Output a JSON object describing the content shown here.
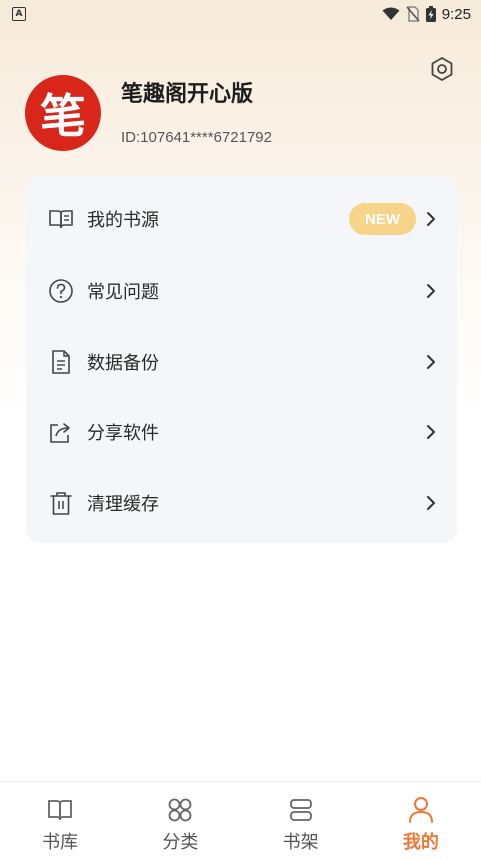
{
  "status_bar": {
    "notif_icon": "A",
    "time": "9:25"
  },
  "profile": {
    "avatar_char": "笔",
    "app_name": "笔趣阁开心版",
    "user_id": "ID:107641****6721792"
  },
  "menu": {
    "items": [
      {
        "label": "我的书源",
        "icon": "book-open-icon",
        "badge": "NEW"
      },
      {
        "label": "常见问题",
        "icon": "question-circle-icon"
      },
      {
        "label": "数据备份",
        "icon": "document-icon"
      },
      {
        "label": "分享软件",
        "icon": "share-icon"
      },
      {
        "label": "清理缓存",
        "icon": "trash-icon"
      }
    ]
  },
  "bottom_nav": {
    "items": [
      {
        "label": "书库",
        "icon": "book-icon"
      },
      {
        "label": "分类",
        "icon": "grid-icon"
      },
      {
        "label": "书架",
        "icon": "shelf-icon"
      },
      {
        "label": "我的",
        "icon": "person-icon",
        "active": true
      }
    ]
  },
  "colors": {
    "accent": "#ee7a36",
    "badge": "#f6d489",
    "avatar": "#d8261b"
  }
}
